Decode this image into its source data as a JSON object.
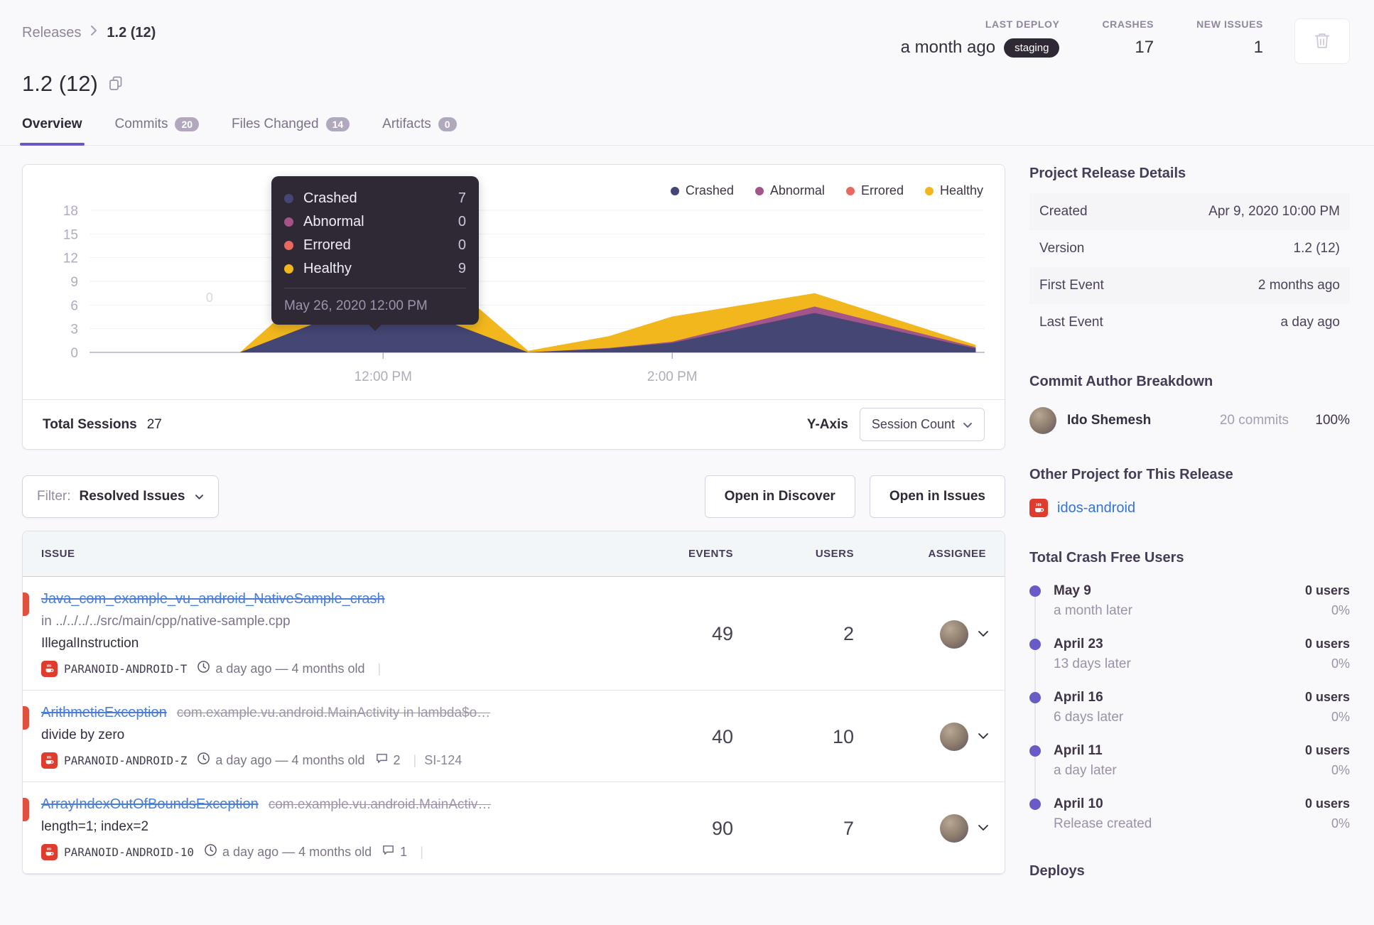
{
  "breadcrumb": {
    "root": "Releases",
    "current": "1.2 (12)"
  },
  "header": {
    "title": "1.2 (12)",
    "stats": [
      {
        "label": "LAST DEPLOY",
        "value": "a month ago",
        "badge": "staging"
      },
      {
        "label": "CRASHES",
        "value": "17"
      },
      {
        "label": "NEW ISSUES",
        "value": "1"
      }
    ]
  },
  "tabs": [
    {
      "label": "Overview"
    },
    {
      "label": "Commits",
      "badge": "20"
    },
    {
      "label": "Files Changed",
      "badge": "14"
    },
    {
      "label": "Artifacts",
      "badge": "0"
    }
  ],
  "chart_data": {
    "type": "area",
    "stacked": true,
    "title": "Release sessions over time",
    "ylim": [
      0,
      18
    ],
    "y_ticks": [
      0,
      3,
      6,
      9,
      12,
      15,
      18
    ],
    "x_ticks": [
      {
        "label": "12:00 PM",
        "f": 0.328
      },
      {
        "label": "2:00 PM",
        "f": 0.651
      }
    ],
    "x_fractions": [
      0.168,
      0.328,
      0.49,
      0.58,
      0.651,
      0.81,
      0.99
    ],
    "series": [
      {
        "name": "Crashed",
        "color": "#444674",
        "values": [
          0,
          7,
          0,
          0.5,
          1.2,
          5,
          0.5
        ]
      },
      {
        "name": "Abnormal",
        "color": "#a35488",
        "values": [
          0,
          0,
          0,
          0.05,
          0.15,
          0.8,
          0.15
        ]
      },
      {
        "name": "Errored",
        "color": "#e9695f",
        "values": [
          0,
          0,
          0,
          0,
          0,
          0,
          0
        ]
      },
      {
        "name": "Healthy",
        "color": "#f1b71c",
        "values": [
          0,
          9,
          0.2,
          1.5,
          3.2,
          1.7,
          0.3
        ]
      }
    ],
    "annotation": {
      "text": "0",
      "f": 0.134,
      "v": 6.4
    },
    "legend_position": "top-right",
    "grid": true
  },
  "chart_card": {
    "tooltip": {
      "rows": [
        {
          "label": "Crashed",
          "value": "7"
        },
        {
          "label": "Abnormal",
          "value": "0"
        },
        {
          "label": "Errored",
          "value": "0"
        },
        {
          "label": "Healthy",
          "value": "9"
        }
      ],
      "date": "May 26, 2020 12:00 PM"
    },
    "footer": {
      "total_label": "Total Sessions",
      "total_value": "27",
      "yaxis_label": "Y-Axis",
      "yaxis_button": "Session Count"
    }
  },
  "filter_bar": {
    "filter_prefix": "Filter:",
    "filter_value": "Resolved Issues",
    "open_discover": "Open in Discover",
    "open_issues": "Open in Issues"
  },
  "issues": {
    "columns": {
      "issue": "ISSUE",
      "events": "EVENTS",
      "users": "USERS",
      "assignee": "ASSIGNEE"
    },
    "rows": [
      {
        "title": "Java_com_example_vu_android_NativeSample_crash",
        "culprit": "",
        "location": "in ../../../../src/main/cpp/native-sample.cpp",
        "message": "IllegalInstruction",
        "project": "PARANOID-ANDROID-T",
        "age": "a day ago — 4 months old",
        "comments": "",
        "ticket": "",
        "events": "49",
        "users": "2"
      },
      {
        "title": "ArithmeticException",
        "culprit": "com.example.vu.android.MainActivity in lambda$o…",
        "location": "",
        "message": "divide by zero",
        "project": "PARANOID-ANDROID-Z",
        "age": "a day ago — 4 months old",
        "comments": "2",
        "ticket": "SI-124",
        "events": "40",
        "users": "10"
      },
      {
        "title": "ArrayIndexOutOfBoundsException",
        "culprit": "com.example.vu.android.MainActiv…",
        "location": "",
        "message": "length=1; index=2",
        "project": "PARANOID-ANDROID-10",
        "age": "a day ago — 4 months old",
        "comments": "1",
        "ticket": "",
        "events": "90",
        "users": "7"
      }
    ]
  },
  "sidebar": {
    "details": {
      "title": "Project Release Details",
      "rows": [
        {
          "label": "Created",
          "value": "Apr 9, 2020 10:00 PM"
        },
        {
          "label": "Version",
          "value": "1.2 (12)"
        },
        {
          "label": "First Event",
          "value": "2 months ago"
        },
        {
          "label": "Last Event",
          "value": "a day ago"
        }
      ]
    },
    "authors": {
      "title": "Commit Author Breakdown",
      "name": "Ido Shemesh",
      "commits": "20 commits",
      "percent": "100%"
    },
    "other_project": {
      "title": "Other Project for This Release",
      "link": "idos-android"
    },
    "crash_free": {
      "title": "Total Crash Free Users",
      "entries": [
        {
          "date": "May 9",
          "sub": "a month later",
          "users": "0 users",
          "pct": "0%"
        },
        {
          "date": "April 23",
          "sub": "13 days later",
          "users": "0 users",
          "pct": "0%"
        },
        {
          "date": "April 16",
          "sub": "6 days later",
          "users": "0 users",
          "pct": "0%"
        },
        {
          "date": "April 11",
          "sub": "a day later",
          "users": "0 users",
          "pct": "0%"
        },
        {
          "date": "April 10",
          "sub": "Release created",
          "users": "0 users",
          "pct": "0%"
        }
      ]
    },
    "deploys_title": "Deploys"
  },
  "icons": {
    "trash": "trash-icon",
    "copy": "copy-icon",
    "clock": "clock-icon",
    "comment": "comment-icon",
    "java_project": "java-project-icon",
    "chevron": "chevron-down-icon"
  },
  "colors": {
    "accent_purple": "#6957c8",
    "crashed": "#444674",
    "abnormal": "#a35488",
    "errored": "#e9695f",
    "healthy": "#f1b71c",
    "issue_link_blue": "#4a7dda",
    "alert_red": "#e0503f",
    "badge_dark": "#2f2936"
  }
}
